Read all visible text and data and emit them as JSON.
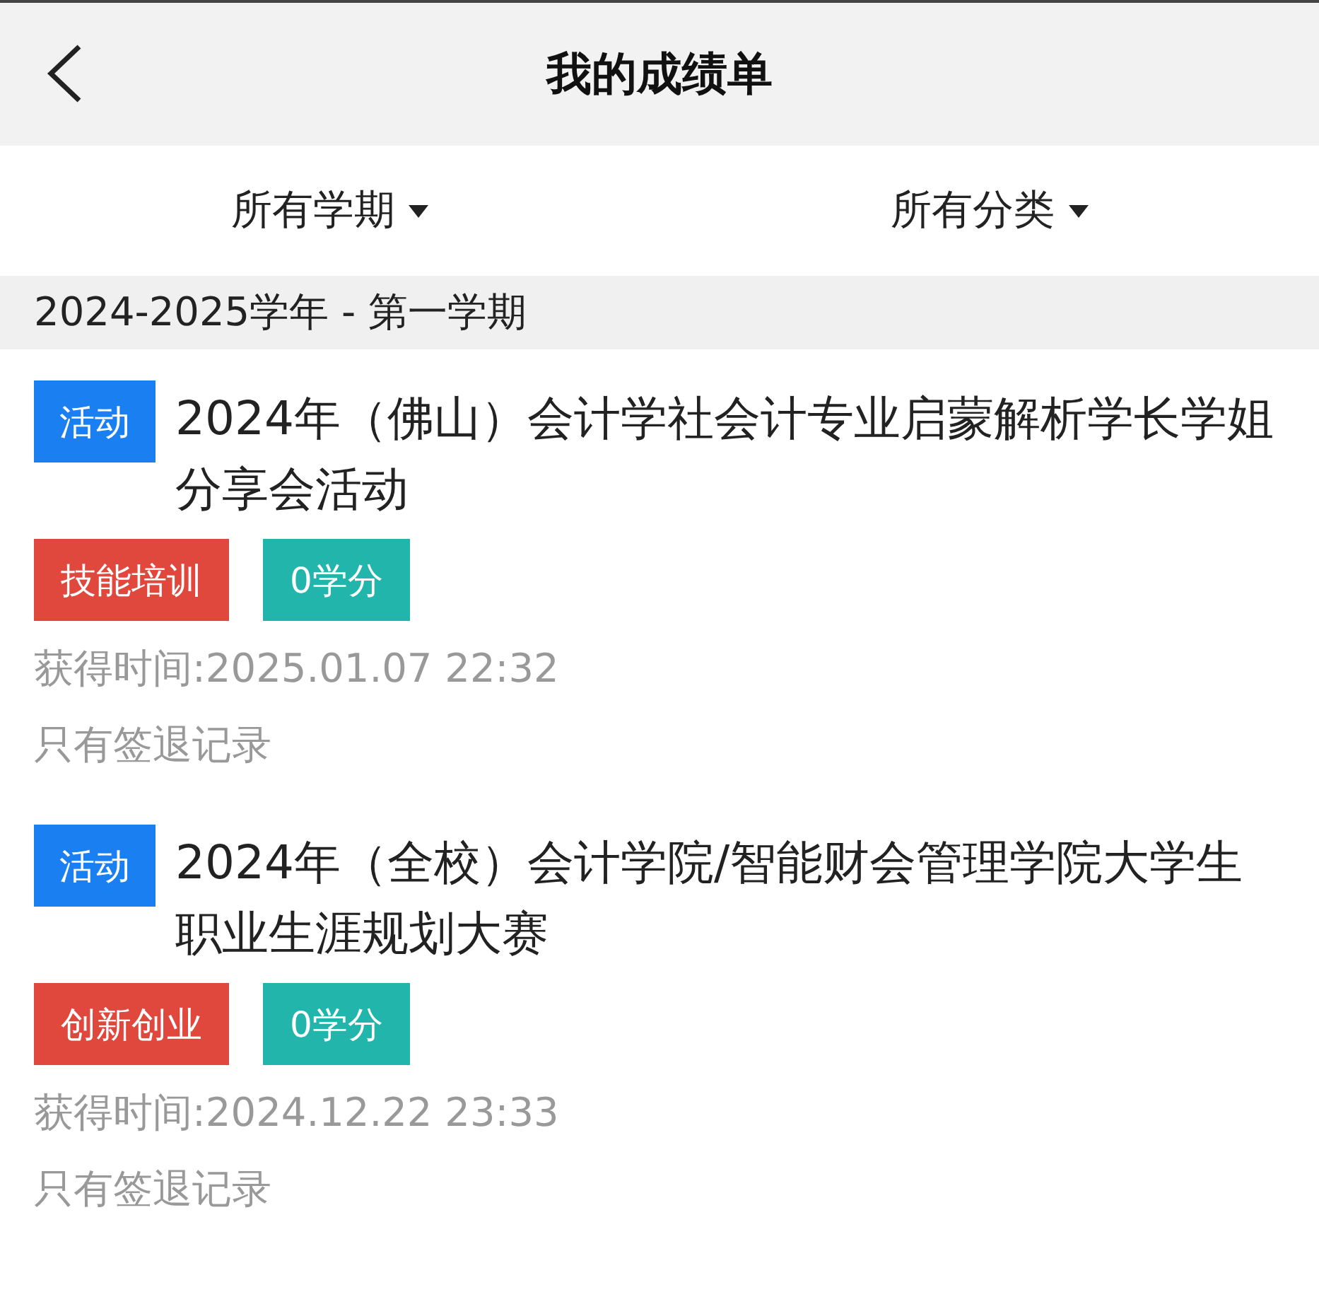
{
  "header": {
    "title": "我的成绩单"
  },
  "filters": [
    {
      "label": "所有学期"
    },
    {
      "label": "所有分类"
    }
  ],
  "section": {
    "title": "2024-2025学年 - 第一学期"
  },
  "records": [
    {
      "type_tag": "活动",
      "title": "2024年（佛山）会计学社会计专业启蒙解析学长学姐分享会活动",
      "tags": [
        {
          "label": "技能培训",
          "color": "#e0473d"
        },
        {
          "label": "0学分",
          "color": "#22b5ac"
        }
      ],
      "time": "获得时间:2025.01.07 22:32",
      "note": "只有签退记录"
    },
    {
      "type_tag": "活动",
      "title": "2024年（全校）会计学院/智能财会管理学院大学生职业生涯规划大赛",
      "tags": [
        {
          "label": "创新创业",
          "color": "#e0473d"
        },
        {
          "label": "0学分",
          "color": "#22b5ac"
        }
      ],
      "time": "获得时间:2024.12.22 23:33",
      "note": "只有签退记录"
    }
  ]
}
